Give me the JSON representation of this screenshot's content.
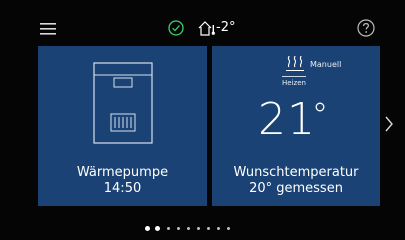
{
  "header": {
    "icons": [
      "menu-icon",
      "check-circle-icon",
      "house-thermometer-icon",
      "help-icon"
    ],
    "outdoor_temperature": "-2°"
  },
  "tiles": [
    {
      "icon": "heat-pump-icon",
      "title": "Wärmepumpe",
      "subtitle": "14:50"
    },
    {
      "icon": "heating-icon",
      "mode": "Manuell",
      "operation": "Heizen",
      "setpoint": "21",
      "setpoint_unit": "°",
      "title": "Wunschtemperatur",
      "subtitle": "20° gemessen"
    }
  ],
  "pager": {
    "total": 9,
    "active": 1
  },
  "colors": {
    "tile": "#1b4274",
    "background": "#050505",
    "ok": "#3ccf6a"
  }
}
